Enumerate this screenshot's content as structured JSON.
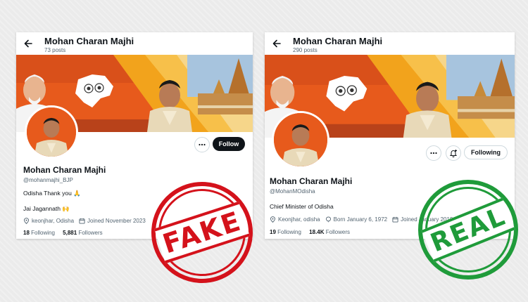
{
  "fake_profile": {
    "header": {
      "name": "Mohan Charan Majhi",
      "posts": "73 posts"
    },
    "name": "Mohan Charan Majhi",
    "handle": "@mohanmajhi_BJP",
    "bio_line1": "Odisha Thank you 🙏",
    "bio_line2": "Jai Jagannath 🙌",
    "location": "keonjhar, Odisha",
    "joined": "Joined November 2023",
    "following_count": "18",
    "following_label": "Following",
    "followers_count": "5,881",
    "followers_label": "Followers",
    "follow_button": "Follow",
    "stamp": "FAKE"
  },
  "real_profile": {
    "header": {
      "name": "Mohan Charan Majhi",
      "posts": "290 posts"
    },
    "name": "Mohan Charan Majhi",
    "handle": "@MohanMOdisha",
    "bio_line1": "Chief Minister of Odisha",
    "location": "Keonjhar, odisha",
    "born": "Born January 6, 1972",
    "joined": "Joined January 2019",
    "following_count": "19",
    "following_label": "Following",
    "followers_count": "18.4K",
    "followers_label": "Followers",
    "follow_button": "Following",
    "stamp": "REAL"
  },
  "icons": {
    "back": "back-arrow-icon",
    "more": "more-options-icon",
    "notify": "notification-bell-icon",
    "location": "location-pin-icon",
    "calendar": "calendar-icon",
    "born": "balloon-icon"
  },
  "colors": {
    "banner_orange": "#e75a1c",
    "fake_stamp": "#d4121b",
    "real_stamp": "#1f9b3a",
    "follow_black": "#0f1419"
  }
}
